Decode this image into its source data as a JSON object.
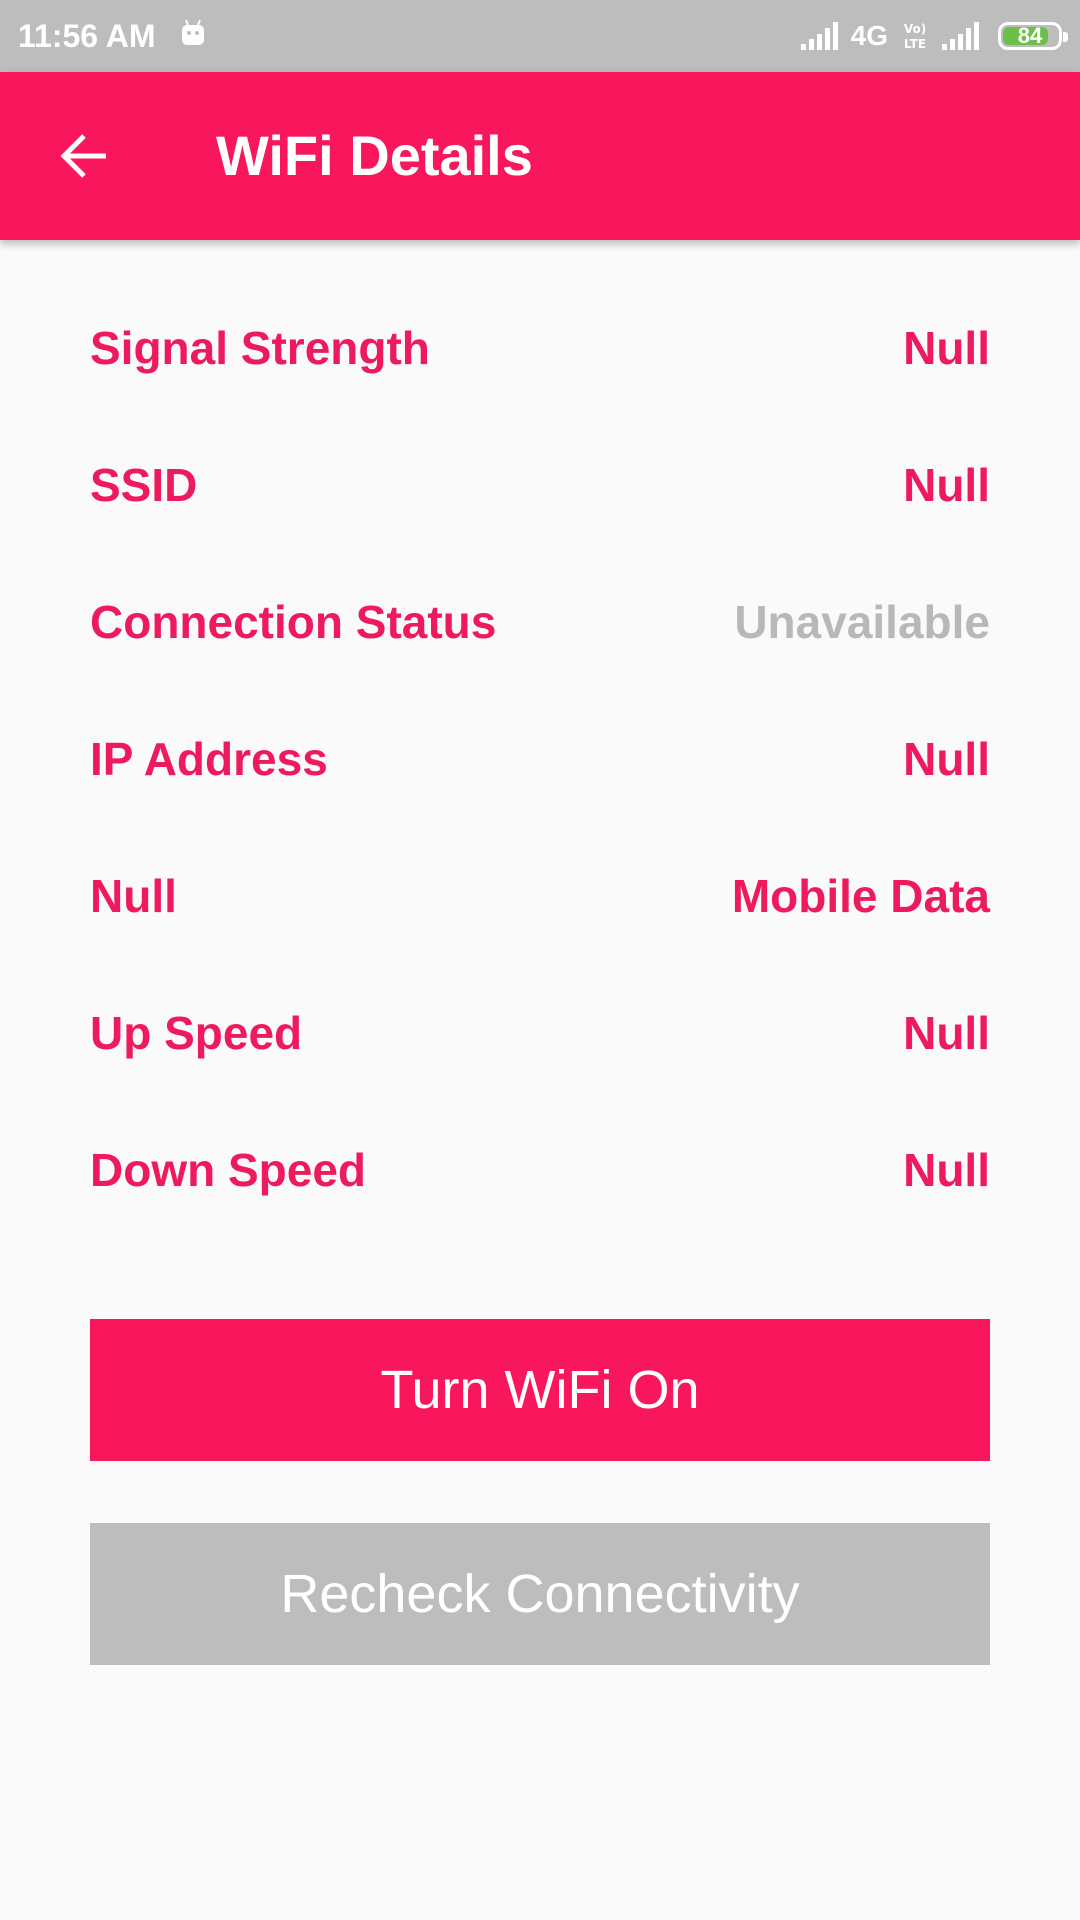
{
  "status_bar": {
    "time": "11:56 AM",
    "network": "4G",
    "battery": "84",
    "battery_level": 0.84,
    "battery_color": "#6cc04a"
  },
  "app_bar": {
    "title": "WiFi Details",
    "color": "#f8175c"
  },
  "details": [
    {
      "label": "Signal Strength",
      "value": "Null"
    },
    {
      "label": "SSID",
      "value": "Null"
    },
    {
      "label": "Connection Status",
      "value": "Unavailable"
    },
    {
      "label": "IP Address",
      "value": "Null"
    },
    {
      "label": "Null",
      "value": "Mobile Data"
    },
    {
      "label": "Up Speed",
      "value": "Null"
    },
    {
      "label": "Down Speed",
      "value": "Null"
    }
  ],
  "buttons": {
    "turn_wifi_on": "Turn WiFi On",
    "recheck": "Recheck Connectivity"
  }
}
